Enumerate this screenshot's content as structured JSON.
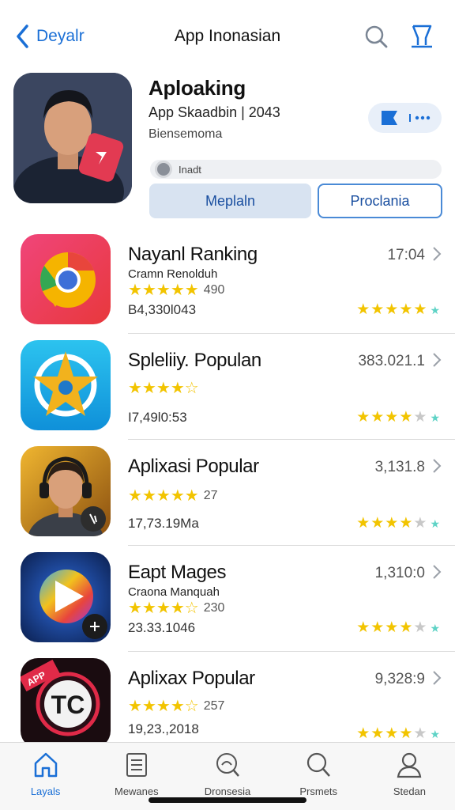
{
  "header": {
    "back_label": "Deyalr",
    "title": "App Inonasian",
    "icons": [
      "back-chevron-icon",
      "search-icon",
      "bookmark-icon"
    ]
  },
  "featured": {
    "name": "Aploaking",
    "subtitle": "App Skaadbin | 2043",
    "publisher": "Biensemoma",
    "search_placeholder": "Inadt",
    "primary_button": "Meplaln",
    "secondary_button": "Proclania",
    "pill_icons": [
      "play-flag-icon",
      "more-icon"
    ]
  },
  "apps": [
    {
      "name": "Nayanl Ranking",
      "developer": "Cramn Renolduh",
      "rating_stars": 4.5,
      "rating_count": "490",
      "size": "B4,330l043",
      "metric": "17:04",
      "right_stars": 4.5,
      "accent": "#e93b6e"
    },
    {
      "name": "Spleliiy. Populan",
      "developer": "",
      "rating_stars": 4,
      "rating_count": "",
      "size": "I7,49l0:53",
      "metric": "383.021.1",
      "right_stars": 3.5,
      "accent": "#1ea7ea"
    },
    {
      "name": "Aplixasi Popular",
      "developer": "",
      "rating_stars": 4.5,
      "rating_count": "27",
      "size": "17,73.19Ma",
      "metric": "3,131.8",
      "right_stars": 3.5,
      "accent": "#e6a21a"
    },
    {
      "name": "Eapt Mages",
      "developer": "Craona Manquah",
      "rating_stars": 4,
      "rating_count": "230",
      "size": "23.33.1046",
      "metric": "1,310:0",
      "right_stars": 4,
      "accent": "#2a7de1"
    },
    {
      "name": "Aplixax Popular",
      "developer": "",
      "rating_stars": 4,
      "rating_count": "257",
      "size": "19,23.,2018",
      "metric": "9,328:9",
      "right_stars": 3.5,
      "accent": "#d8213a"
    }
  ],
  "tabs": [
    {
      "label": "Layals",
      "icon": "home-icon",
      "active": true
    },
    {
      "label": "Mewanes",
      "icon": "document-icon",
      "active": false
    },
    {
      "label": "Dronsesia",
      "icon": "discover-icon",
      "active": false
    },
    {
      "label": "Prsmets",
      "icon": "search-icon",
      "active": false
    },
    {
      "label": "Stedan",
      "icon": "profile-icon",
      "active": false
    }
  ],
  "colors": {
    "accent_blue": "#1a6fd6",
    "star_gold": "#f2c400",
    "star_teal": "#5fd3c6"
  }
}
